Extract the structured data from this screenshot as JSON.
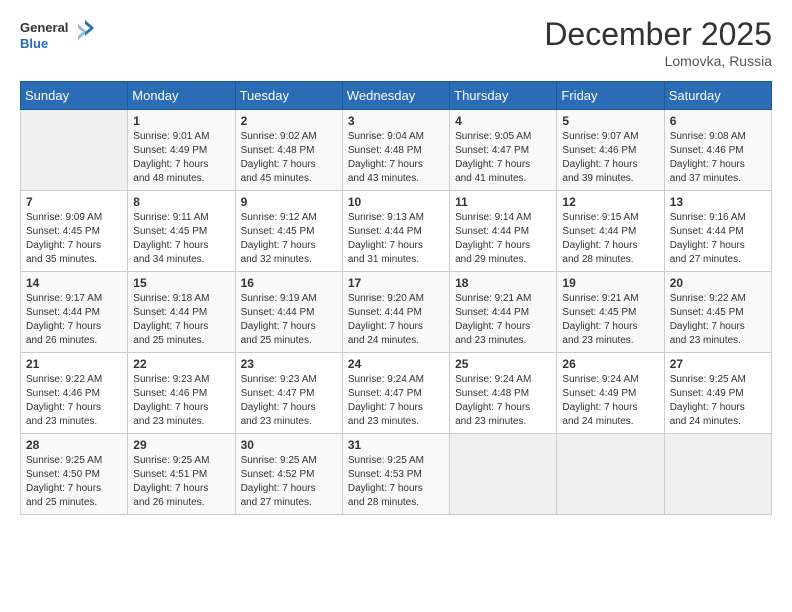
{
  "logo": {
    "line1": "General",
    "line2": "Blue"
  },
  "title": "December 2025",
  "location": "Lomovka, Russia",
  "weekdays": [
    "Sunday",
    "Monday",
    "Tuesday",
    "Wednesday",
    "Thursday",
    "Friday",
    "Saturday"
  ],
  "weeks": [
    [
      {
        "day": "",
        "info": ""
      },
      {
        "day": "1",
        "info": "Sunrise: 9:01 AM\nSunset: 4:49 PM\nDaylight: 7 hours\nand 48 minutes."
      },
      {
        "day": "2",
        "info": "Sunrise: 9:02 AM\nSunset: 4:48 PM\nDaylight: 7 hours\nand 45 minutes."
      },
      {
        "day": "3",
        "info": "Sunrise: 9:04 AM\nSunset: 4:48 PM\nDaylight: 7 hours\nand 43 minutes."
      },
      {
        "day": "4",
        "info": "Sunrise: 9:05 AM\nSunset: 4:47 PM\nDaylight: 7 hours\nand 41 minutes."
      },
      {
        "day": "5",
        "info": "Sunrise: 9:07 AM\nSunset: 4:46 PM\nDaylight: 7 hours\nand 39 minutes."
      },
      {
        "day": "6",
        "info": "Sunrise: 9:08 AM\nSunset: 4:46 PM\nDaylight: 7 hours\nand 37 minutes."
      }
    ],
    [
      {
        "day": "7",
        "info": "Sunrise: 9:09 AM\nSunset: 4:45 PM\nDaylight: 7 hours\nand 35 minutes."
      },
      {
        "day": "8",
        "info": "Sunrise: 9:11 AM\nSunset: 4:45 PM\nDaylight: 7 hours\nand 34 minutes."
      },
      {
        "day": "9",
        "info": "Sunrise: 9:12 AM\nSunset: 4:45 PM\nDaylight: 7 hours\nand 32 minutes."
      },
      {
        "day": "10",
        "info": "Sunrise: 9:13 AM\nSunset: 4:44 PM\nDaylight: 7 hours\nand 31 minutes."
      },
      {
        "day": "11",
        "info": "Sunrise: 9:14 AM\nSunset: 4:44 PM\nDaylight: 7 hours\nand 29 minutes."
      },
      {
        "day": "12",
        "info": "Sunrise: 9:15 AM\nSunset: 4:44 PM\nDaylight: 7 hours\nand 28 minutes."
      },
      {
        "day": "13",
        "info": "Sunrise: 9:16 AM\nSunset: 4:44 PM\nDaylight: 7 hours\nand 27 minutes."
      }
    ],
    [
      {
        "day": "14",
        "info": "Sunrise: 9:17 AM\nSunset: 4:44 PM\nDaylight: 7 hours\nand 26 minutes."
      },
      {
        "day": "15",
        "info": "Sunrise: 9:18 AM\nSunset: 4:44 PM\nDaylight: 7 hours\nand 25 minutes."
      },
      {
        "day": "16",
        "info": "Sunrise: 9:19 AM\nSunset: 4:44 PM\nDaylight: 7 hours\nand 25 minutes."
      },
      {
        "day": "17",
        "info": "Sunrise: 9:20 AM\nSunset: 4:44 PM\nDaylight: 7 hours\nand 24 minutes."
      },
      {
        "day": "18",
        "info": "Sunrise: 9:21 AM\nSunset: 4:44 PM\nDaylight: 7 hours\nand 23 minutes."
      },
      {
        "day": "19",
        "info": "Sunrise: 9:21 AM\nSunset: 4:45 PM\nDaylight: 7 hours\nand 23 minutes."
      },
      {
        "day": "20",
        "info": "Sunrise: 9:22 AM\nSunset: 4:45 PM\nDaylight: 7 hours\nand 23 minutes."
      }
    ],
    [
      {
        "day": "21",
        "info": "Sunrise: 9:22 AM\nSunset: 4:46 PM\nDaylight: 7 hours\nand 23 minutes."
      },
      {
        "day": "22",
        "info": "Sunrise: 9:23 AM\nSunset: 4:46 PM\nDaylight: 7 hours\nand 23 minutes."
      },
      {
        "day": "23",
        "info": "Sunrise: 9:23 AM\nSunset: 4:47 PM\nDaylight: 7 hours\nand 23 minutes."
      },
      {
        "day": "24",
        "info": "Sunrise: 9:24 AM\nSunset: 4:47 PM\nDaylight: 7 hours\nand 23 minutes."
      },
      {
        "day": "25",
        "info": "Sunrise: 9:24 AM\nSunset: 4:48 PM\nDaylight: 7 hours\nand 23 minutes."
      },
      {
        "day": "26",
        "info": "Sunrise: 9:24 AM\nSunset: 4:49 PM\nDaylight: 7 hours\nand 24 minutes."
      },
      {
        "day": "27",
        "info": "Sunrise: 9:25 AM\nSunset: 4:49 PM\nDaylight: 7 hours\nand 24 minutes."
      }
    ],
    [
      {
        "day": "28",
        "info": "Sunrise: 9:25 AM\nSunset: 4:50 PM\nDaylight: 7 hours\nand 25 minutes."
      },
      {
        "day": "29",
        "info": "Sunrise: 9:25 AM\nSunset: 4:51 PM\nDaylight: 7 hours\nand 26 minutes."
      },
      {
        "day": "30",
        "info": "Sunrise: 9:25 AM\nSunset: 4:52 PM\nDaylight: 7 hours\nand 27 minutes."
      },
      {
        "day": "31",
        "info": "Sunrise: 9:25 AM\nSunset: 4:53 PM\nDaylight: 7 hours\nand 28 minutes."
      },
      {
        "day": "",
        "info": ""
      },
      {
        "day": "",
        "info": ""
      },
      {
        "day": "",
        "info": ""
      }
    ]
  ]
}
